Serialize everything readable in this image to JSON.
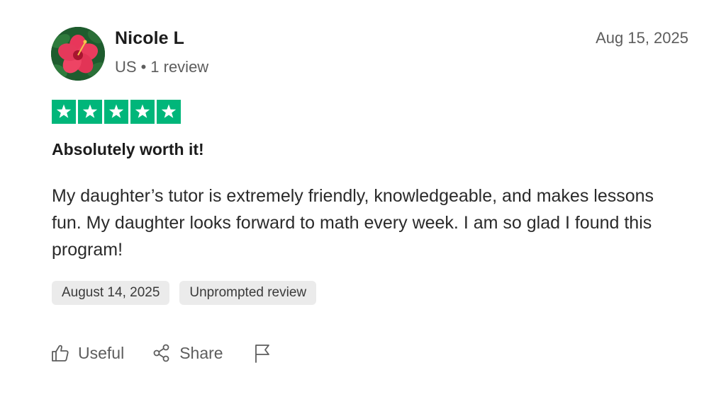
{
  "reviewer": {
    "name": "Nicole L",
    "country": "US",
    "separator": "•",
    "review_count": "1 review",
    "avatar_icon": "hibiscus-flower-avatar"
  },
  "review": {
    "date_posted": "Aug 15, 2025",
    "rating": 5,
    "rating_max": 5,
    "star_color": "#00b67a",
    "title": "Absolutely worth it!",
    "body": "My daughter’s tutor is extremely friendly, knowledgeable, and makes lessons fun. My daughter looks forward to math every week. I am so glad I found this program!",
    "tags": [
      {
        "label": "August 14, 2025"
      },
      {
        "label": "Unprompted review"
      }
    ]
  },
  "actions": {
    "useful_label": "Useful",
    "useful_icon": "thumbs-up-icon",
    "share_label": "Share",
    "share_icon": "share-icon",
    "report_icon": "flag-icon"
  }
}
